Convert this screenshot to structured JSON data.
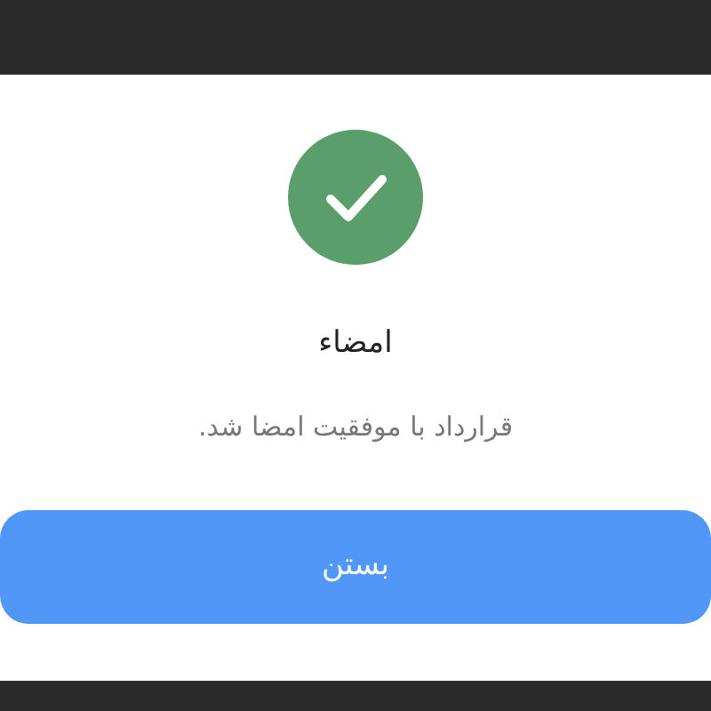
{
  "dialog": {
    "title": "امضاء",
    "message": "قرارداد با موفقیت امضا شد.",
    "button": "بستن"
  }
}
